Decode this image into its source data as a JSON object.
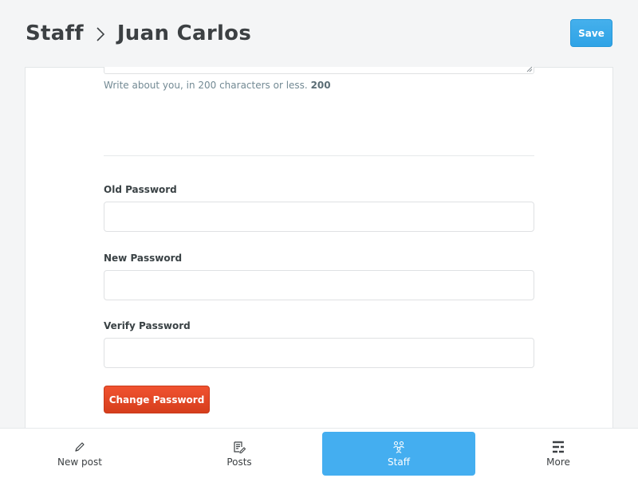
{
  "header": {
    "breadcrumb_root": "Staff",
    "breadcrumb_current": "Juan Carlos",
    "save_label": "Save"
  },
  "bio": {
    "hint_text": "Write about you, in 200 characters or less.",
    "char_count": "200"
  },
  "password": {
    "old_label": "Old Password",
    "old_value": "",
    "new_label": "New Password",
    "new_value": "",
    "verify_label": "Verify Password",
    "verify_value": "",
    "change_button_label": "Change Password"
  },
  "bottom_nav": {
    "items": [
      {
        "label": "New post",
        "icon": "pencil-icon"
      },
      {
        "label": "Posts",
        "icon": "document-icon"
      },
      {
        "label": "Staff",
        "icon": "team-icon",
        "active": true
      },
      {
        "label": "More",
        "icon": "menu-icon"
      }
    ]
  },
  "colors": {
    "accent_blue": "#44aef0",
    "danger_red": "#e5492a",
    "background": "#f4f5f6"
  }
}
